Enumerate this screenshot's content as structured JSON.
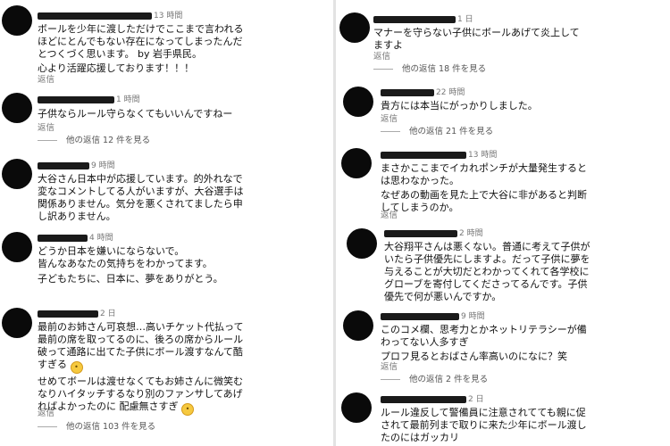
{
  "left": {
    "comments": [
      {
        "time": "13 時間",
        "body": [
          "ボールを少年に渡しただけでここまで言われる",
          "ほどにとんでもない存在になってしまったんだ",
          "とつくづく思います。 by 岩手県民。",
          "心より活躍応援しております！！！"
        ],
        "reply": "返信",
        "more": ""
      },
      {
        "time": "1 時間",
        "body": [
          "子供ならルール守らなくてもいいんですねー"
        ],
        "reply": "返信",
        "more": "他の返信 12 件を見る"
      },
      {
        "time": "9 時間",
        "body": [
          "大谷さん日本中が応援しています。的外れなで",
          "変なコメントしてる人がいますが、大谷選手は",
          "関係ありません。気分を悪くされてましたら申",
          "し訳ありません。"
        ],
        "reply": "",
        "more": ""
      },
      {
        "time": "4 時間",
        "body": [
          "どうか日本を嫌いにならないで。",
          "皆んなあなたの気持ちをわかってます。",
          "子どもたちに、日本に、夢をありがとう。"
        ],
        "reply": "",
        "more": ""
      },
      {
        "time": "2 日",
        "body": [
          "最前のお姉さん可哀想…高いチケット代払って",
          "最前の席を取ってるのに、後ろの席からルール",
          "破って通路に出てた子供にボール渡すなんて酷",
          "すぎる",
          "せめてボールは渡せなくてもお姉さんに微笑む",
          "なりハイタッチするなり別のファンサしてあげ",
          "ればよかったのに 配慮無さすぎ"
        ],
        "reply": "返信",
        "more": "他の返信 103 件を見る"
      }
    ]
  },
  "right": {
    "comments": [
      {
        "time": "1 日",
        "body": [
          "マナーを守らない子供にボールあげて炎上して",
          "ますよ"
        ],
        "reply": "返信",
        "more": "他の返信 18 件を見る"
      },
      {
        "time": "22 時間",
        "body": [
          "貴方には本当にがっかりしました。"
        ],
        "reply": "返信",
        "more": "他の返信 21 件を見る"
      },
      {
        "time": "13 時間",
        "body": [
          "まさかここまでイカれポンチが大量発生すると",
          "は思わなかった。",
          "なぜあの動画を見た上で大谷に非があると判断",
          "してしまうのか。"
        ],
        "reply": "返信",
        "more": ""
      },
      {
        "time": "2 時間",
        "body": [
          "大谷翔平さんは悪くない。普通に考えて子供が",
          "いたら子供優先にしますよ。だって子供に夢を",
          "与えることが大切だとわかってくれて各学校に",
          "グローブを寄付してくださってるんです。子供",
          "優先で何が悪いんですか。"
        ],
        "reply": "",
        "more": ""
      },
      {
        "time": "9 時間",
        "body": [
          "このコメ欄、思考力とかネットリテラシーが備",
          "わってない人多すぎ",
          "プロフ見るとおばさん率高いのになに？笑"
        ],
        "reply": "返信",
        "more": "他の返信 2 件を見る"
      },
      {
        "time": "2 日",
        "body": [
          "ルール違反して警備員に注意されてても親に促",
          "されて最前列まで取りに来た少年にボール渡し",
          "たのにはガッカリ"
        ],
        "reply": "",
        "more": ""
      }
    ]
  }
}
